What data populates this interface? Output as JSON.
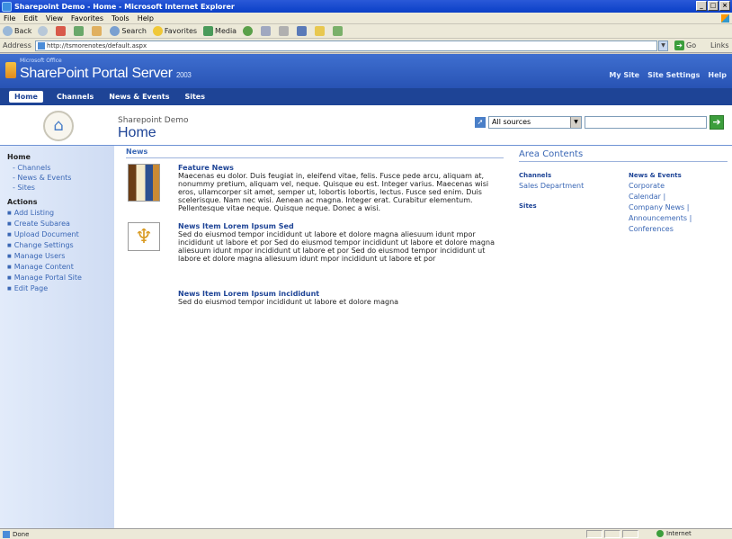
{
  "window": {
    "title": "Sharepoint Demo - Home - Microsoft Internet Explorer"
  },
  "menu": [
    "File",
    "Edit",
    "View",
    "Favorites",
    "Tools",
    "Help"
  ],
  "toolbar": {
    "back": "Back",
    "search": "Search",
    "favorites": "Favorites",
    "media": "Media"
  },
  "address": {
    "label": "Address",
    "url": "http://tsmorenotes/default.aspx",
    "go": "Go",
    "links": "Links"
  },
  "portal": {
    "small": "Microsoft Office",
    "name": "SharePoint Portal Server",
    "year": "2003",
    "top_links": [
      "My Site",
      "Site Settings",
      "Help"
    ]
  },
  "nav": {
    "tabs": [
      "Home",
      "Channels",
      "News & Events",
      "Sites"
    ]
  },
  "site": {
    "subtitle": "Sharepoint Demo",
    "title": "Home"
  },
  "search": {
    "scope": "All sources",
    "placeholder": ""
  },
  "leftnav": {
    "home": "Home",
    "subs": [
      "- Channels",
      "- News & Events",
      "- Sites"
    ],
    "actions_head": "Actions",
    "actions": [
      "Add Listing",
      "Create Subarea",
      "Upload Document",
      "Change Settings",
      "Manage Users",
      "Manage Content",
      "Manage Portal Site",
      "Edit Page"
    ]
  },
  "news": {
    "heading": "News",
    "items": [
      {
        "title": "Feature News",
        "body": "Maecenas eu dolor. Duis feugiat in, eleifend vitae, felis. Fusce pede arcu, aliquam at, nonummy pretium, aliquam vel, neque. Quisque eu est. Integer varius. Maecenas wisi eros, ullamcorper sit amet, semper ut, lobortis lobortis, lectus. Fusce sed enim. Duis scelerisque. Nam nec wisi. Aenean ac magna. Integer erat. Curabitur elementum. Pellentesque vitae neque. Quisque neque. Donec a wisi."
      },
      {
        "title": "News Item Lorem Ipsum Sed",
        "body": "Sed do eiusmod tempor incididunt ut labore et dolore magna aliesuum idunt mpor incididunt ut labore et por Sed do eiusmod tempor incididunt ut labore et dolore magna aliesuum idunt mpor incididunt ut labore et por Sed do eiusmod tempor incididunt ut labore et dolore magna aliesuum idunt mpor incididunt ut labore et por"
      },
      {
        "title": "News Item Lorem Ipsum incididunt",
        "body": "Sed do eiusmod tempor incididunt ut labore et dolore magna"
      }
    ]
  },
  "area": {
    "title": "Area Contents",
    "channels_head": "Channels",
    "channels": [
      "Sales Department"
    ],
    "sites_head": "Sites",
    "news_head": "News & Events",
    "news_links": [
      "Corporate",
      "Calendar |",
      "Company News |",
      "Announcements |",
      "Conferences"
    ]
  },
  "status": {
    "text": "Done",
    "zone": "Internet"
  }
}
